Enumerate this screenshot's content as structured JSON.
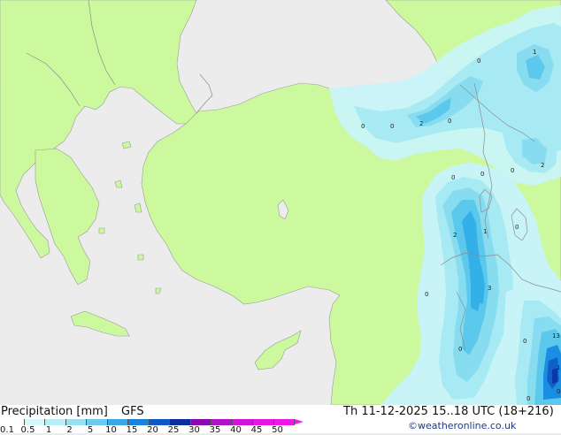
{
  "map": {
    "region": "Eastern Mediterranean / Anatolia",
    "colors": {
      "sea": "#ececec",
      "land": "#ccf99e",
      "precip_0_1": "#c8f4f8",
      "precip_0_5": "#a8eaf4",
      "precip_1": "#88dcf0",
      "precip_2": "#5cc8ec",
      "precip_5": "#34b0e8",
      "precip_10": "#1a8ee0",
      "precip_15": "#1060c8",
      "precip_20": "#0a38a8"
    },
    "contour_labels": [
      "0",
      "1",
      "0",
      "0",
      "0",
      "2",
      "0",
      "0",
      "0",
      "0",
      "2",
      "2",
      "1",
      "0",
      "3",
      "0",
      "0",
      "0",
      "13",
      "0",
      "1"
    ]
  },
  "footer": {
    "title": "Precipitation [mm]",
    "model": "GFS",
    "datetime": "Th 11-12-2025 15..18 UTC (18+216)",
    "copyright": "©weatheronline.co.uk"
  },
  "legend": {
    "ticks": [
      "0.1",
      "0.5",
      "1",
      "2",
      "5",
      "10",
      "15",
      "20",
      "25",
      "30",
      "35",
      "40",
      "45",
      "50"
    ],
    "colors": [
      "#ffffff",
      "#d6f8fa",
      "#b8eef6",
      "#96e0f2",
      "#6ccaee",
      "#3aa8e6",
      "#1a82dc",
      "#0e58c4",
      "#0a2e9e",
      "#8a0ab0",
      "#b012c8",
      "#d014d8",
      "#e816e0",
      "#f018e8"
    ]
  }
}
